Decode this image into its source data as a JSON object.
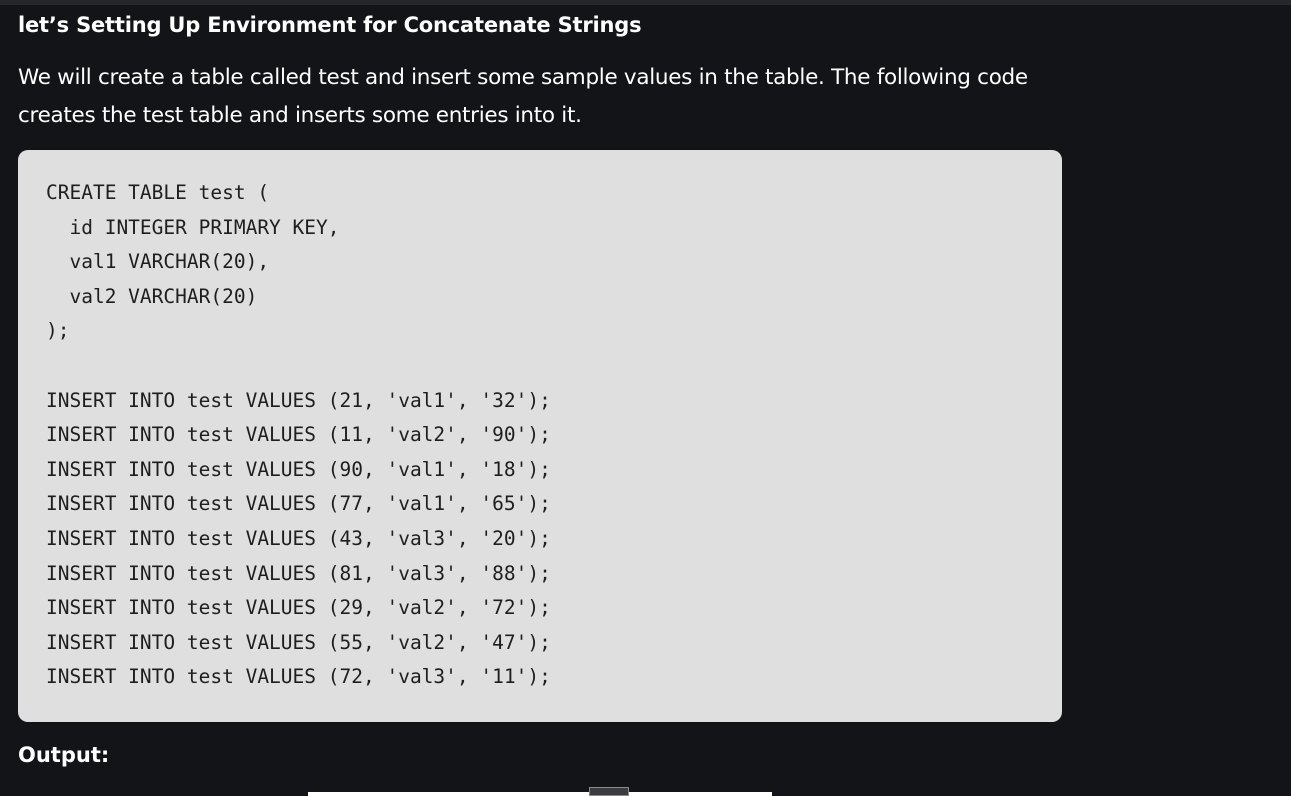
{
  "article": {
    "heading": "let’s Setting Up Environment for Concatenate Strings",
    "intro": "We will create a table called test and insert some sample values in the table. The following code creates the test table and inserts some entries into it.",
    "code_lines": [
      "CREATE TABLE test (",
      "  id INTEGER PRIMARY KEY,",
      "  val1 VARCHAR(20),",
      "  val2 VARCHAR(20)",
      ");",
      "",
      "INSERT INTO test VALUES (21, 'val1', '32');",
      "INSERT INTO test VALUES (11, 'val2', '90');",
      "INSERT INTO test VALUES (90, 'val1', '18');",
      "INSERT INTO test VALUES (77, 'val1', '65');",
      "INSERT INTO test VALUES (43, 'val3', '20');",
      "INSERT INTO test VALUES (81, 'val3', '88');",
      "INSERT INTO test VALUES (29, 'val2', '72');",
      "INSERT INTO test VALUES (55, 'val2', '47');",
      "INSERT INTO test VALUES (72, 'val3', '11');"
    ],
    "output_label": "Output:"
  },
  "colors": {
    "page_background": "#131417",
    "code_background": "#dfdfdf",
    "code_text": "#1e1e1e",
    "text": "#ffffff"
  }
}
